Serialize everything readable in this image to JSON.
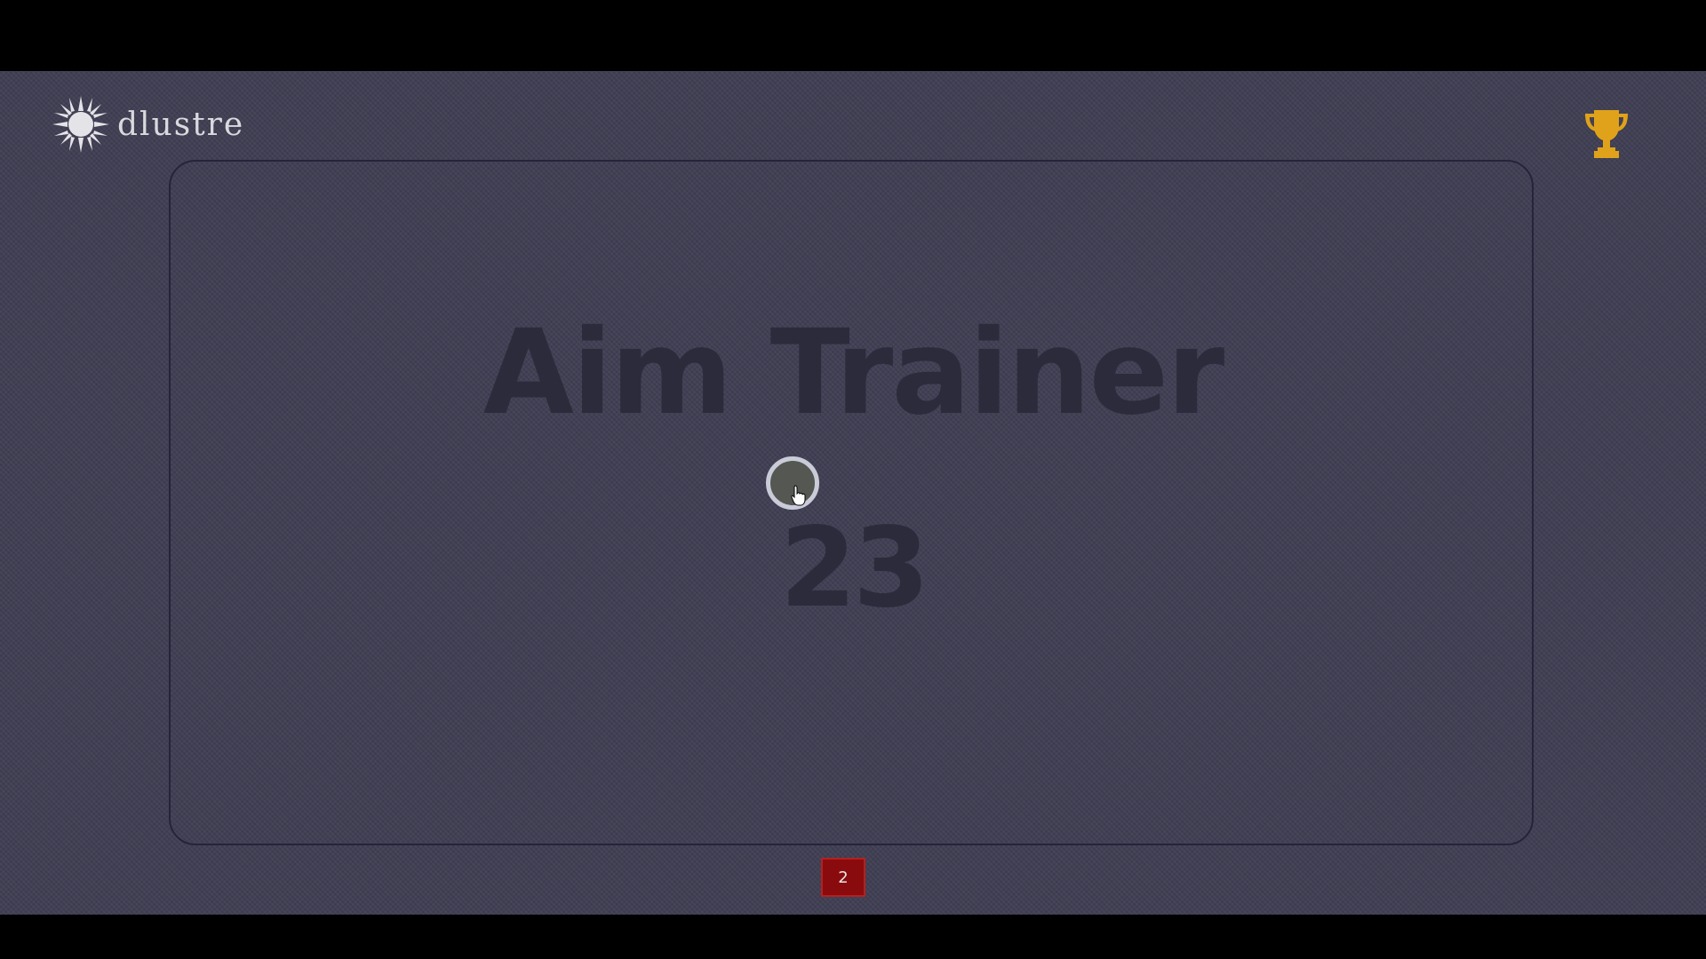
{
  "brand": {
    "name": "dlustre"
  },
  "header": {
    "leaderboard_icon": "trophy-icon"
  },
  "game": {
    "title": "Aim Trainer",
    "score": "23",
    "target_icon": "target-circle"
  },
  "footer": {
    "counter": "2"
  },
  "colors": {
    "background": "#3f3e53",
    "title_text": "#2c2b3b",
    "target_fill": "#555752",
    "target_ring": "#c9ccd8",
    "trophy": "#e0a21a",
    "counter_badge": "#8a0b0d"
  }
}
